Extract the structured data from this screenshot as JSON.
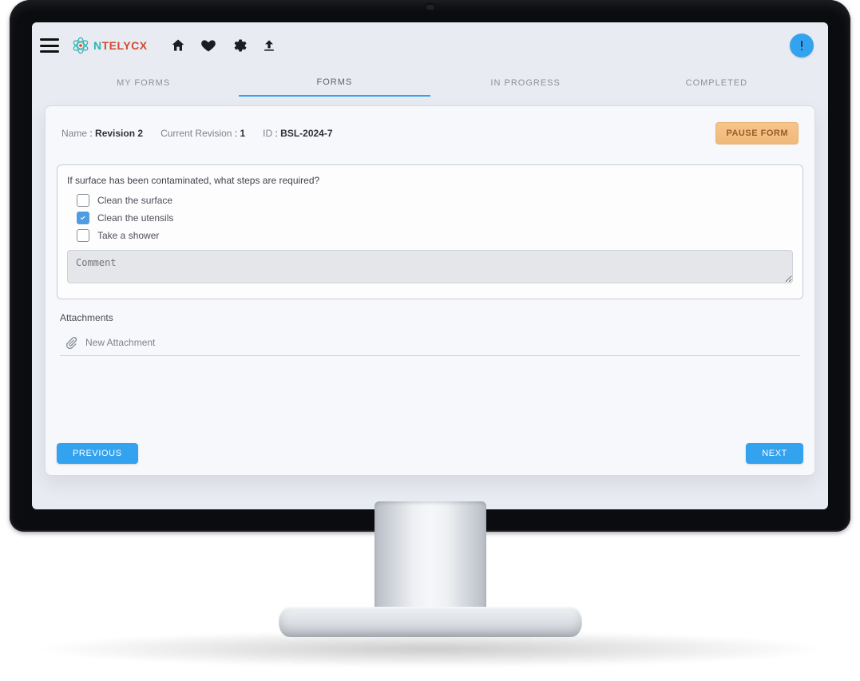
{
  "brand": {
    "name_a": "N",
    "name_b": "TELYCX"
  },
  "tabs": [
    {
      "label": "MY FORMS",
      "active": false
    },
    {
      "label": "FORMS",
      "active": true
    },
    {
      "label": "IN PROGRESS",
      "active": false
    },
    {
      "label": "COMPLETED",
      "active": false
    }
  ],
  "meta": {
    "name_label": "Name",
    "name_value": "Revision 2",
    "rev_label": "Current Revision",
    "rev_value": "1",
    "id_label": "ID",
    "id_value": "BSL-2024-7",
    "pause_label": "PAUSE FORM"
  },
  "question": {
    "text": "If surface has been contaminated, what steps are required?",
    "options": [
      {
        "label": "Clean the surface",
        "checked": false
      },
      {
        "label": "Clean the utensils",
        "checked": true
      },
      {
        "label": "Take a shower",
        "checked": false
      }
    ],
    "comment_placeholder": "Comment"
  },
  "attachments": {
    "title": "Attachments",
    "new_label": "New Attachment"
  },
  "nav": {
    "prev": "PREVIOUS",
    "next": "NEXT"
  },
  "colors": {
    "accent": "#34a3ef",
    "pause": "#f6c48b",
    "brand_teal": "#2fb4b0",
    "brand_red": "#d24a2e"
  }
}
